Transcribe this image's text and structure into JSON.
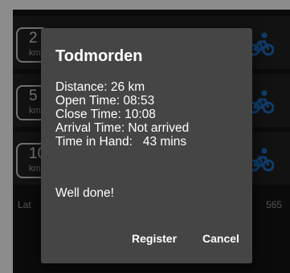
{
  "list": {
    "rows": [
      {
        "distance": "2",
        "unit": "km"
      },
      {
        "distance": "5",
        "unit": "km"
      },
      {
        "distance": "10",
        "unit": "km"
      }
    ],
    "footer_left": "Lat",
    "footer_right": "565"
  },
  "dialog": {
    "title": "Todmorden",
    "lines": [
      "Distance: 26 km",
      "Open Time: 08:53",
      "Close Time: 10:08",
      "Arrival Time: Not arrived",
      "Time in Hand:   43 mins"
    ],
    "message": "Well done!",
    "register_label": "Register",
    "cancel_label": "Cancel"
  },
  "colors": {
    "accent_bike": "#1e6fc8",
    "dialog_bg": "#454545",
    "row_bg": "#222222"
  },
  "icons": [
    "bicycle-icon"
  ]
}
